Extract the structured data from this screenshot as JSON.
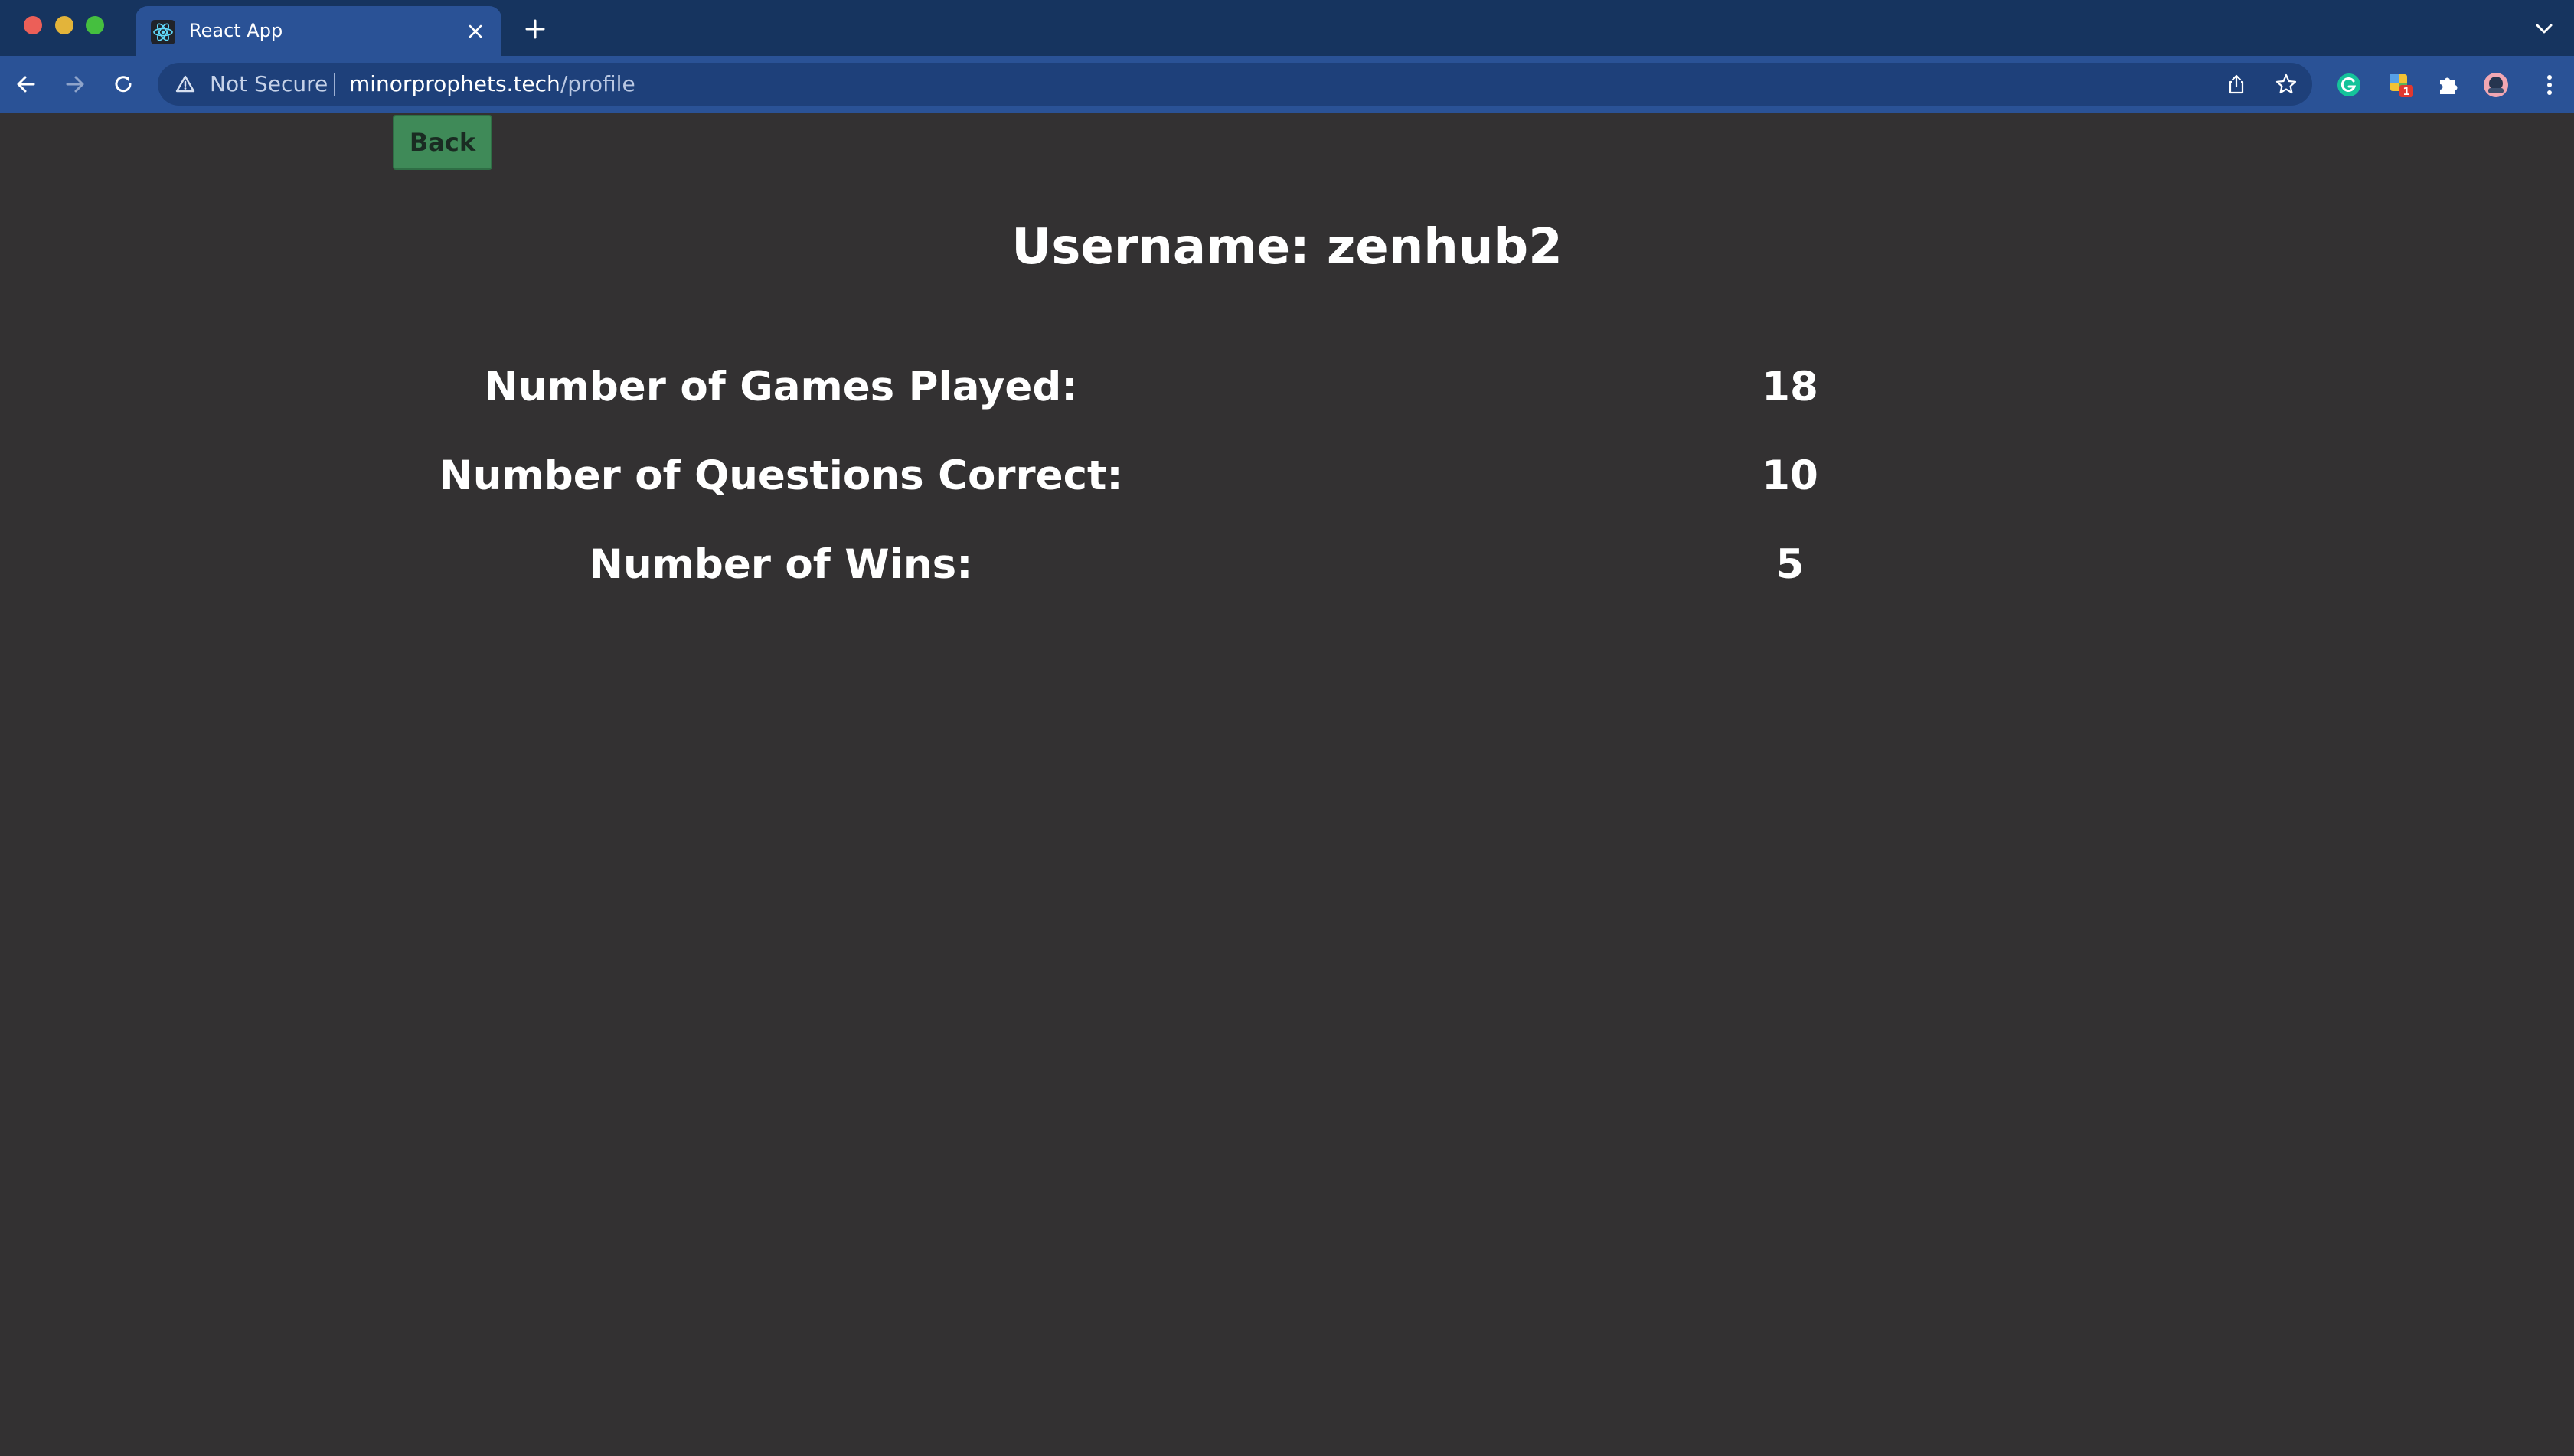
{
  "browser": {
    "tab": {
      "title": "React App",
      "favicon": "react-logo-icon"
    },
    "address_bar": {
      "security_label": "Not Secure",
      "url_host": "minorprophets.tech",
      "url_path": "/profile"
    },
    "extensions": [
      "grammarly-icon",
      "calendar-extension-icon",
      "puzzle-icon",
      "profile-avatar",
      "menu-dots-icon"
    ],
    "extension_badge": "1"
  },
  "page": {
    "back_label": "Back",
    "username_line": "Username: zenhub2",
    "stats": [
      {
        "label": "Number of Games Played:",
        "value": "18"
      },
      {
        "label": "Number of Questions Correct:",
        "value": "10"
      },
      {
        "label": "Number of Wins:",
        "value": "5"
      }
    ]
  },
  "colors": {
    "page_background": "#333132",
    "back_button": "#3f8a58",
    "chrome_frame": "#16345f",
    "chrome_toolbar": "#2a5296"
  }
}
